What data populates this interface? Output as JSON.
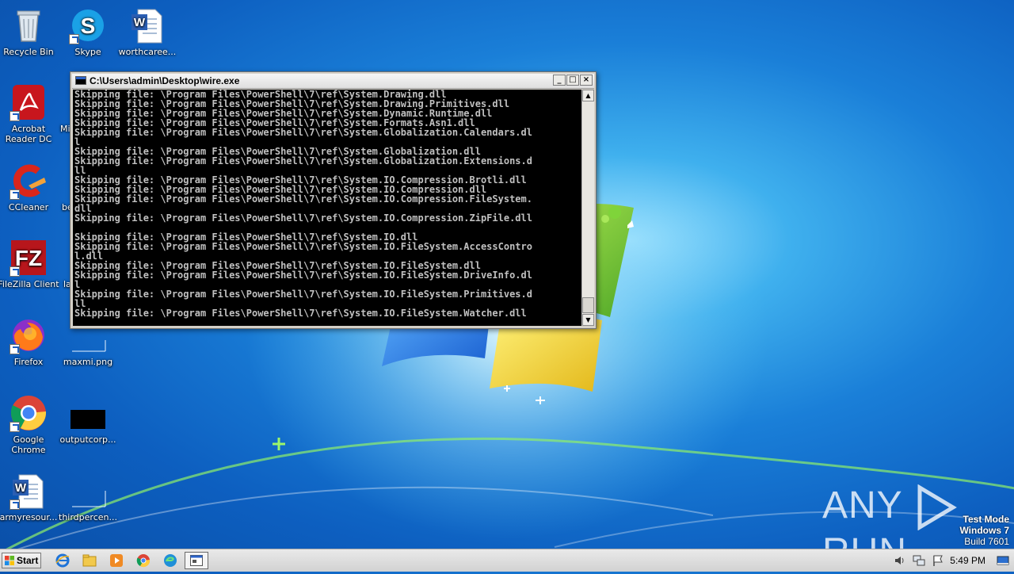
{
  "desktop": {
    "icons": [
      {
        "label": "Recycle Bin",
        "icon": "recycle-bin-icon"
      },
      {
        "label": "Skype",
        "icon": "skype-icon"
      },
      {
        "label": "worthcaree...",
        "icon": "word-document-icon"
      },
      {
        "label": "Acrobat Reader DC",
        "icon": "acrobat-icon"
      },
      {
        "label": "Mi",
        "icon": "partial-icon"
      },
      {
        "label": "CCleaner",
        "icon": "ccleaner-icon"
      },
      {
        "label": "be",
        "icon": "partial-icon"
      },
      {
        "label": "FileZilla Client",
        "icon": "filezilla-icon"
      },
      {
        "label": "la",
        "icon": "partial-icon"
      },
      {
        "label": "Firefox",
        "icon": "firefox-icon"
      },
      {
        "label": "maxmi.png",
        "icon": "image-file-icon"
      },
      {
        "label": "Google Chrome",
        "icon": "chrome-icon"
      },
      {
        "label": "outputcorp...",
        "icon": "black-image-icon"
      },
      {
        "label": "armyresour...",
        "icon": "word-document-icon"
      },
      {
        "label": "thirdpercen...",
        "icon": "blank-file-icon"
      }
    ]
  },
  "console_window": {
    "title": "C:\\Users\\admin\\Desktop\\wire.exe",
    "minimize": "_",
    "maximize": "□",
    "close": "×",
    "lines": [
      "Skipping file: \\Program Files\\PowerShell\\7\\ref\\System.Drawing.dll",
      "Skipping file: \\Program Files\\PowerShell\\7\\ref\\System.Drawing.Primitives.dll",
      "Skipping file: \\Program Files\\PowerShell\\7\\ref\\System.Dynamic.Runtime.dll",
      "Skipping file: \\Program Files\\PowerShell\\7\\ref\\System.Formats.Asn1.dll",
      "Skipping file: \\Program Files\\PowerShell\\7\\ref\\System.Globalization.Calendars.dl",
      "l",
      "Skipping file: \\Program Files\\PowerShell\\7\\ref\\System.Globalization.dll",
      "Skipping file: \\Program Files\\PowerShell\\7\\ref\\System.Globalization.Extensions.d",
      "ll",
      "Skipping file: \\Program Files\\PowerShell\\7\\ref\\System.IO.Compression.Brotli.dll",
      "Skipping file: \\Program Files\\PowerShell\\7\\ref\\System.IO.Compression.dll",
      "Skipping file: \\Program Files\\PowerShell\\7\\ref\\System.IO.Compression.FileSystem.",
      "dll",
      "Skipping file: \\Program Files\\PowerShell\\7\\ref\\System.IO.Compression.ZipFile.dll",
      "",
      "Skipping file: \\Program Files\\PowerShell\\7\\ref\\System.IO.dll",
      "Skipping file: \\Program Files\\PowerShell\\7\\ref\\System.IO.FileSystem.AccessContro",
      "l.dll",
      "Skipping file: \\Program Files\\PowerShell\\7\\ref\\System.IO.FileSystem.dll",
      "Skipping file: \\Program Files\\PowerShell\\7\\ref\\System.IO.FileSystem.DriveInfo.dl",
      "l",
      "Skipping file: \\Program Files\\PowerShell\\7\\ref\\System.IO.FileSystem.Primitives.d",
      "ll",
      "Skipping file: \\Program Files\\PowerShell\\7\\ref\\System.IO.FileSystem.Watcher.dll"
    ]
  },
  "taskbar": {
    "start_label": "Start",
    "clock": "5:49 PM"
  },
  "watermark": {
    "left": "ANY",
    "right": "RUN"
  },
  "system_info": {
    "line1": "Test Mode",
    "line2": "Windows 7",
    "line3": "Build 7601"
  }
}
